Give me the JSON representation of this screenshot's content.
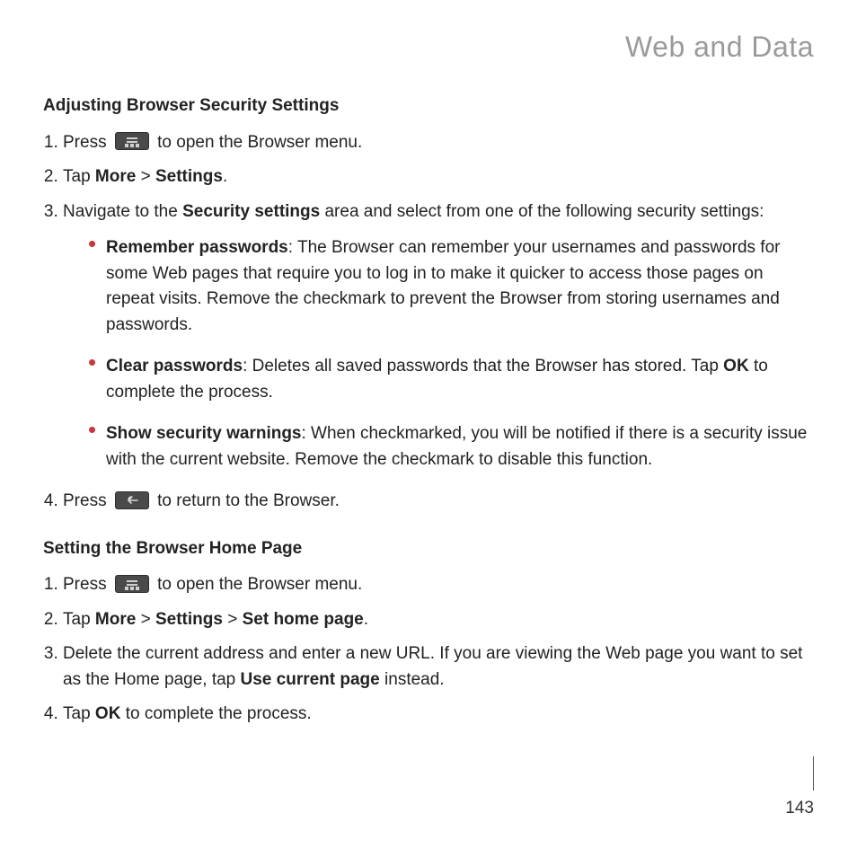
{
  "header": {
    "title": "Web and Data"
  },
  "page_number": "143",
  "section1": {
    "heading": "Adjusting Browser Security Settings",
    "step1_pre": "Press ",
    "step1_post": " to open the Browser menu.",
    "step2_pre": "Tap ",
    "step2_more": "More",
    "step2_gt": " > ",
    "step2_settings": "Settings",
    "step2_end": ".",
    "step3_pre": "Navigate to the ",
    "step3_bold": "Security settings",
    "step3_post": " area and select from one of the following security settings:",
    "bullets": {
      "b1_bold": "Remember passwords",
      "b1_rest": ": The Browser can remember your usernames and passwords for some Web pages that require you to log in to make it quicker to access those pages on repeat visits. Remove the checkmark to prevent the Browser from storing usernames and passwords.",
      "b2_bold": "Clear passwords",
      "b2_rest_a": ": Deletes all saved passwords that the Browser has stored. Tap ",
      "b2_ok": "OK",
      "b2_rest_b": " to complete the process.",
      "b3_bold": "Show security warnings",
      "b3_rest": ": When checkmarked, you will be notified if there is a security issue with the current website. Remove the checkmark to disable this function."
    },
    "step4_pre": "Press ",
    "step4_post": " to return to the Browser."
  },
  "section2": {
    "heading": "Setting the Browser Home Page",
    "step1_pre": "Press ",
    "step1_post": " to open the Browser menu.",
    "step2_pre": "Tap ",
    "step2_more": "More",
    "step2_sp1": "  > ",
    "step2_settings": "Settings",
    "step2_gt2": " > ",
    "step2_home": "Set home page",
    "step2_end": ".",
    "step3_a": "Delete the current address and enter a new URL. If you are viewing the Web page you want to set as the Home page, tap ",
    "step3_bold": "Use current page",
    "step3_b": " instead.",
    "step4_pre": "Tap ",
    "step4_ok": "OK",
    "step4_post": " to complete the process."
  }
}
